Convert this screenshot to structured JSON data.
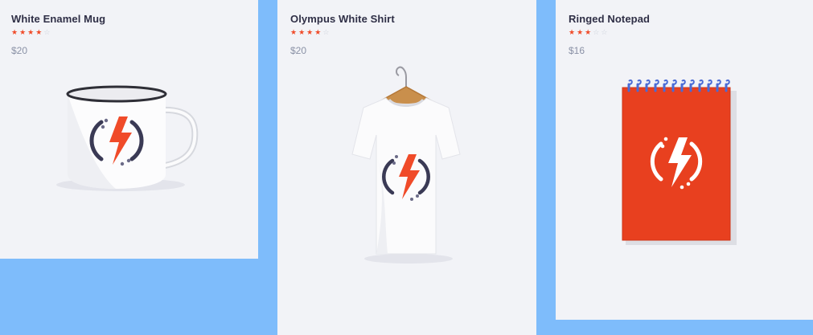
{
  "products": [
    {
      "title": "White Enamel Mug",
      "rating": 4,
      "max_rating": 5,
      "price": "$20",
      "image": "enamel-mug-with-lightning-logo"
    },
    {
      "title": "Olympus White Shirt",
      "rating": 4,
      "max_rating": 5,
      "price": "$20",
      "image": "white-tshirt-on-hanger-with-lightning-logo"
    },
    {
      "title": "Ringed Notepad",
      "rating": 3,
      "max_rating": 5,
      "price": "$16",
      "image": "red-spiral-notepad-with-lightning-logo"
    }
  ],
  "colors": {
    "page_background": "#7ebcfb",
    "card_background": "#f2f3f7",
    "brand_orange": "#f04b29",
    "title_text": "#2f2f46",
    "price_text": "#8a91a6",
    "star_empty": "#cbd0da"
  }
}
